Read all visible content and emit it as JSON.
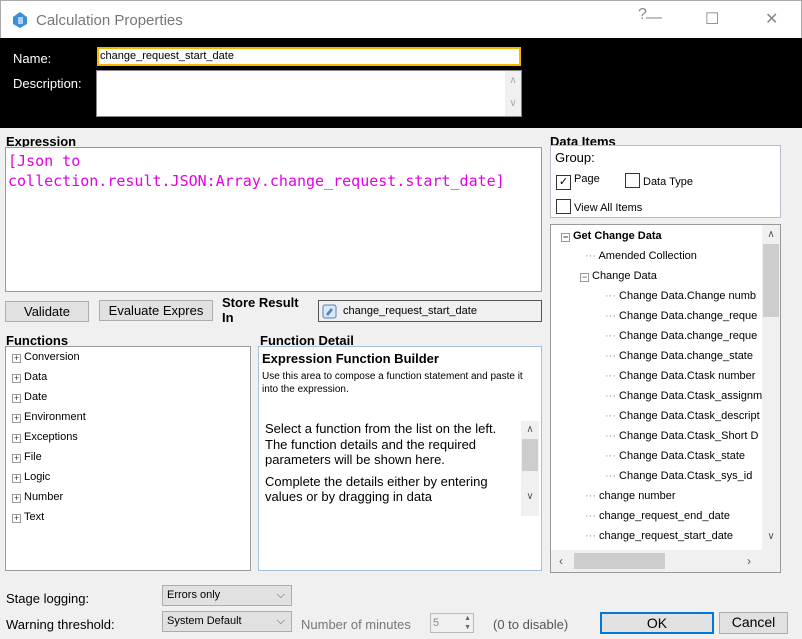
{
  "window": {
    "title": "Calculation Properties",
    "help": "?",
    "minimize": "—",
    "maximize": "☐",
    "close": "✕"
  },
  "header": {
    "name_label": "Name:",
    "name_value": "change_request_start_date",
    "description_label": "Description:",
    "description_value": ""
  },
  "expression": {
    "label": "Expression",
    "value": "[Json to collection.result.JSON:Array.change_request.start_date]"
  },
  "actions": {
    "validate": "Validate",
    "evaluate": "Evaluate Expres",
    "store_label": "Store Result In",
    "store_value": "change_request_start_date"
  },
  "functions": {
    "label": "Functions",
    "items": [
      "Conversion",
      "Data",
      "Date",
      "Environment",
      "Exceptions",
      "File",
      "Logic",
      "Number",
      "Text"
    ]
  },
  "function_detail": {
    "label": "Function Detail",
    "heading": "Expression Function Builder",
    "hint": "Use this area to compose a function statement and paste it into the expression.",
    "body1": "Select a function from the list on the left. The function details and the required parameters will be shown here.",
    "body2": "Complete the details either by entering values or by dragging in data"
  },
  "data_items": {
    "label": "Data Items",
    "group_label": "Group:",
    "page": "Page",
    "page_checked": true,
    "data_type": "Data Type",
    "view_all": "View All Items",
    "root": "Get Change Data",
    "child1": "Amended Collection",
    "group": "Change Data",
    "group_items": [
      "Change Data.Change numb",
      "Change Data.change_reque",
      "Change Data.change_reque",
      "Change Data.change_state",
      "Change Data.Ctask number",
      "Change Data.Ctask_assignm",
      "Change Data.Ctask_descript",
      "Change Data.Ctask_Short D",
      "Change Data.Ctask_state",
      "Change Data.Ctask_sys_id"
    ],
    "others": [
      "change number",
      "change_request_end_date",
      "change_request_start_date"
    ]
  },
  "footer": {
    "stage_logging_label": "Stage logging:",
    "stage_logging_value": "Errors only",
    "warning_label": "Warning threshold:",
    "warning_value": "System Default",
    "minutes_label": "Number of minutes",
    "minutes_value": "5",
    "disable_hint": "(0 to disable)",
    "ok": "OK",
    "cancel": "Cancel"
  }
}
